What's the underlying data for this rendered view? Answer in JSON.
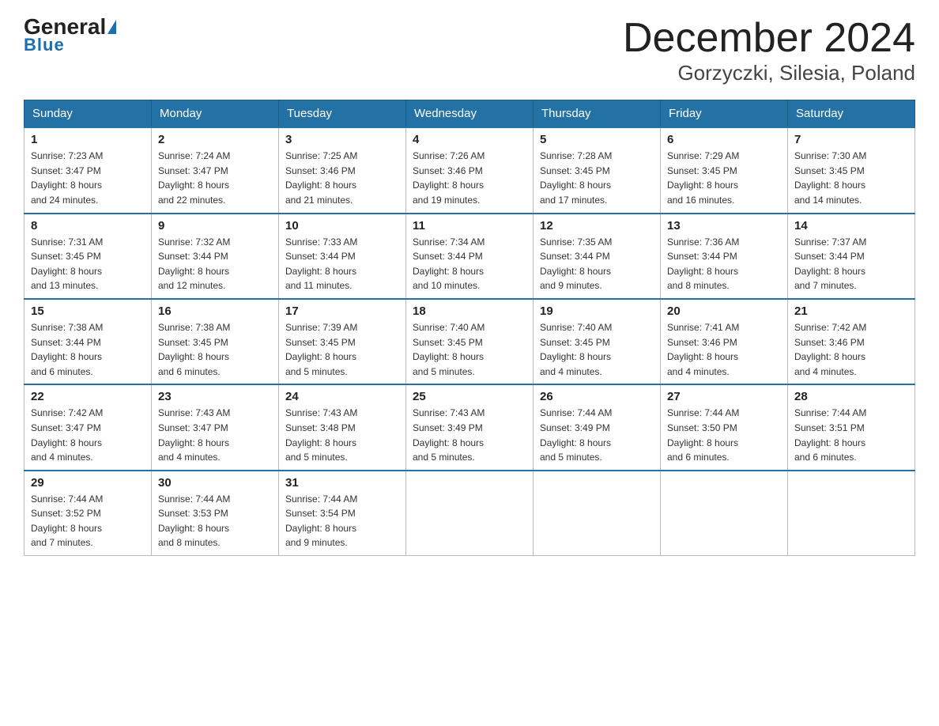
{
  "header": {
    "logo_general": "General",
    "logo_blue": "Blue",
    "title": "December 2024",
    "subtitle": "Gorzyczki, Silesia, Poland"
  },
  "weekdays": [
    "Sunday",
    "Monday",
    "Tuesday",
    "Wednesday",
    "Thursday",
    "Friday",
    "Saturday"
  ],
  "weeks": [
    [
      {
        "day": "1",
        "sunrise": "7:23 AM",
        "sunset": "3:47 PM",
        "daylight": "8 hours and 24 minutes."
      },
      {
        "day": "2",
        "sunrise": "7:24 AM",
        "sunset": "3:47 PM",
        "daylight": "8 hours and 22 minutes."
      },
      {
        "day": "3",
        "sunrise": "7:25 AM",
        "sunset": "3:46 PM",
        "daylight": "8 hours and 21 minutes."
      },
      {
        "day": "4",
        "sunrise": "7:26 AM",
        "sunset": "3:46 PM",
        "daylight": "8 hours and 19 minutes."
      },
      {
        "day": "5",
        "sunrise": "7:28 AM",
        "sunset": "3:45 PM",
        "daylight": "8 hours and 17 minutes."
      },
      {
        "day": "6",
        "sunrise": "7:29 AM",
        "sunset": "3:45 PM",
        "daylight": "8 hours and 16 minutes."
      },
      {
        "day": "7",
        "sunrise": "7:30 AM",
        "sunset": "3:45 PM",
        "daylight": "8 hours and 14 minutes."
      }
    ],
    [
      {
        "day": "8",
        "sunrise": "7:31 AM",
        "sunset": "3:45 PM",
        "daylight": "8 hours and 13 minutes."
      },
      {
        "day": "9",
        "sunrise": "7:32 AM",
        "sunset": "3:44 PM",
        "daylight": "8 hours and 12 minutes."
      },
      {
        "day": "10",
        "sunrise": "7:33 AM",
        "sunset": "3:44 PM",
        "daylight": "8 hours and 11 minutes."
      },
      {
        "day": "11",
        "sunrise": "7:34 AM",
        "sunset": "3:44 PM",
        "daylight": "8 hours and 10 minutes."
      },
      {
        "day": "12",
        "sunrise": "7:35 AM",
        "sunset": "3:44 PM",
        "daylight": "8 hours and 9 minutes."
      },
      {
        "day": "13",
        "sunrise": "7:36 AM",
        "sunset": "3:44 PM",
        "daylight": "8 hours and 8 minutes."
      },
      {
        "day": "14",
        "sunrise": "7:37 AM",
        "sunset": "3:44 PM",
        "daylight": "8 hours and 7 minutes."
      }
    ],
    [
      {
        "day": "15",
        "sunrise": "7:38 AM",
        "sunset": "3:44 PM",
        "daylight": "8 hours and 6 minutes."
      },
      {
        "day": "16",
        "sunrise": "7:38 AM",
        "sunset": "3:45 PM",
        "daylight": "8 hours and 6 minutes."
      },
      {
        "day": "17",
        "sunrise": "7:39 AM",
        "sunset": "3:45 PM",
        "daylight": "8 hours and 5 minutes."
      },
      {
        "day": "18",
        "sunrise": "7:40 AM",
        "sunset": "3:45 PM",
        "daylight": "8 hours and 5 minutes."
      },
      {
        "day": "19",
        "sunrise": "7:40 AM",
        "sunset": "3:45 PM",
        "daylight": "8 hours and 4 minutes."
      },
      {
        "day": "20",
        "sunrise": "7:41 AM",
        "sunset": "3:46 PM",
        "daylight": "8 hours and 4 minutes."
      },
      {
        "day": "21",
        "sunrise": "7:42 AM",
        "sunset": "3:46 PM",
        "daylight": "8 hours and 4 minutes."
      }
    ],
    [
      {
        "day": "22",
        "sunrise": "7:42 AM",
        "sunset": "3:47 PM",
        "daylight": "8 hours and 4 minutes."
      },
      {
        "day": "23",
        "sunrise": "7:43 AM",
        "sunset": "3:47 PM",
        "daylight": "8 hours and 4 minutes."
      },
      {
        "day": "24",
        "sunrise": "7:43 AM",
        "sunset": "3:48 PM",
        "daylight": "8 hours and 5 minutes."
      },
      {
        "day": "25",
        "sunrise": "7:43 AM",
        "sunset": "3:49 PM",
        "daylight": "8 hours and 5 minutes."
      },
      {
        "day": "26",
        "sunrise": "7:44 AM",
        "sunset": "3:49 PM",
        "daylight": "8 hours and 5 minutes."
      },
      {
        "day": "27",
        "sunrise": "7:44 AM",
        "sunset": "3:50 PM",
        "daylight": "8 hours and 6 minutes."
      },
      {
        "day": "28",
        "sunrise": "7:44 AM",
        "sunset": "3:51 PM",
        "daylight": "8 hours and 6 minutes."
      }
    ],
    [
      {
        "day": "29",
        "sunrise": "7:44 AM",
        "sunset": "3:52 PM",
        "daylight": "8 hours and 7 minutes."
      },
      {
        "day": "30",
        "sunrise": "7:44 AM",
        "sunset": "3:53 PM",
        "daylight": "8 hours and 8 minutes."
      },
      {
        "day": "31",
        "sunrise": "7:44 AM",
        "sunset": "3:54 PM",
        "daylight": "8 hours and 9 minutes."
      },
      null,
      null,
      null,
      null
    ]
  ],
  "labels": {
    "sunrise": "Sunrise:",
    "sunset": "Sunset:",
    "daylight": "Daylight:"
  }
}
